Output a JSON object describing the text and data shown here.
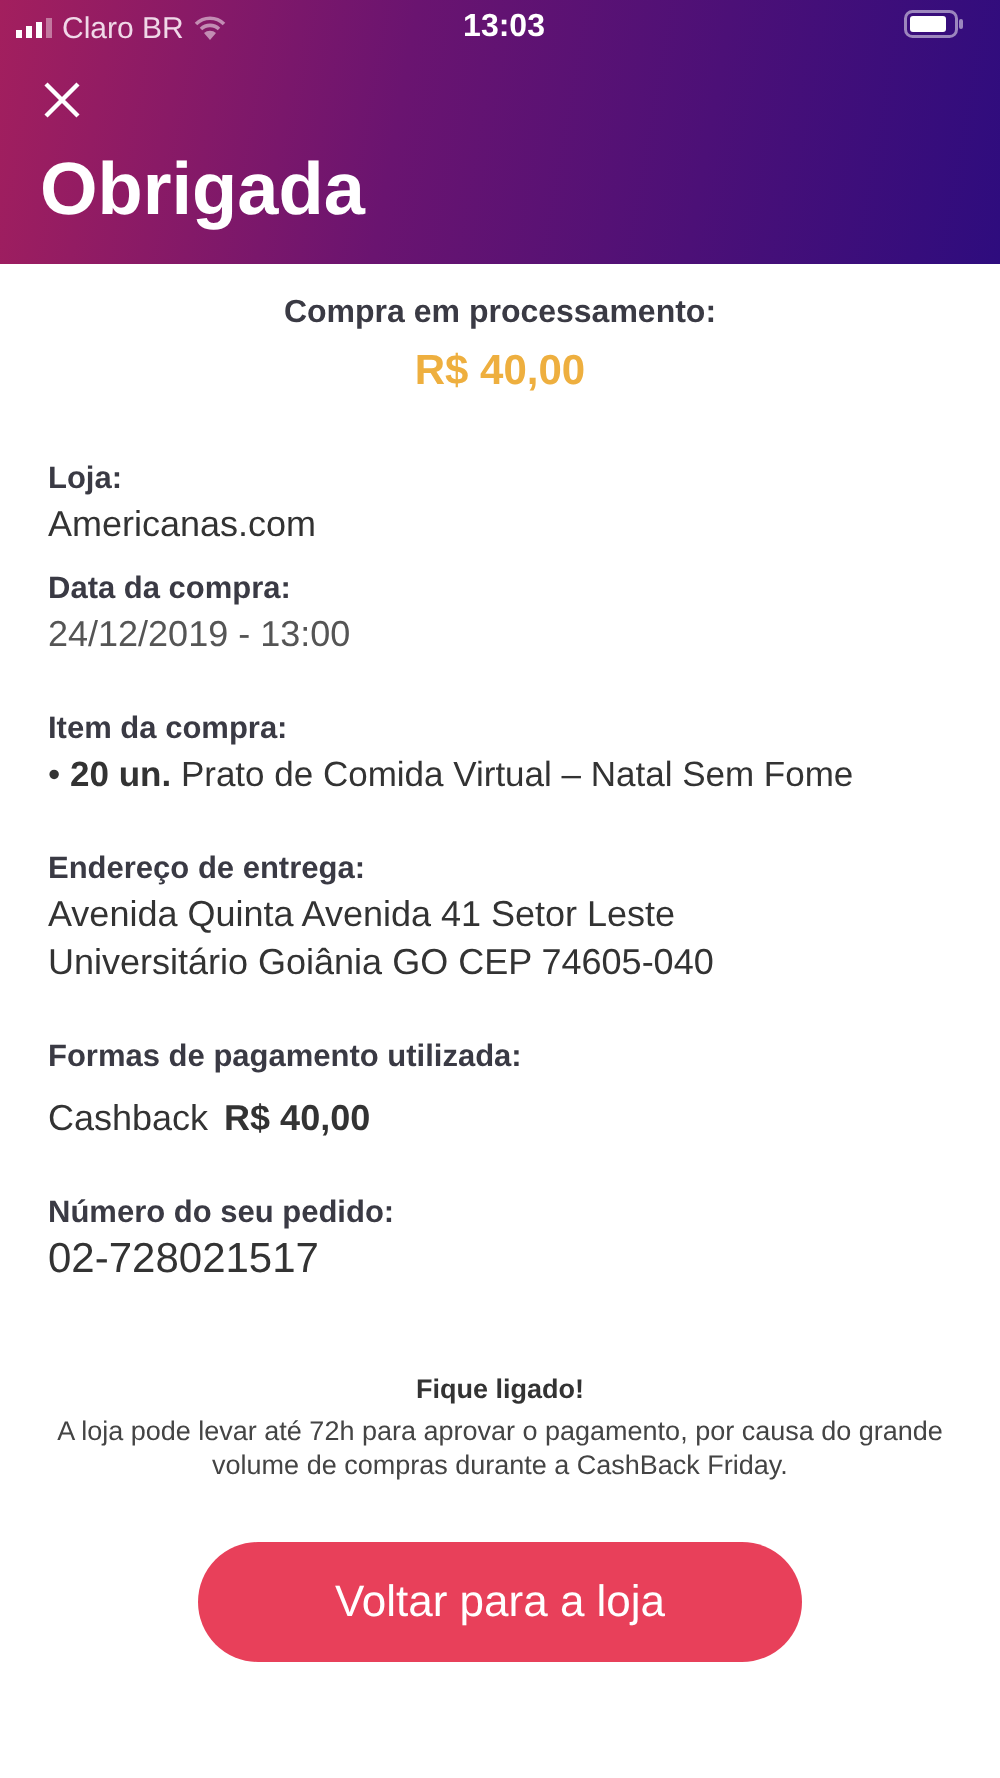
{
  "status_bar": {
    "carrier": "Claro BR",
    "time": "13:03"
  },
  "header": {
    "title": "Obrigada"
  },
  "summary": {
    "label": "Compra em processamento:",
    "amount": "R$ 40,00"
  },
  "store": {
    "label": "Loja:",
    "value": "Americanas.com"
  },
  "date": {
    "label": "Data da compra:",
    "value": "24/12/2019 - 13:00"
  },
  "items": {
    "label": "Item da compra:",
    "lines": [
      "• **20 un.** Prato de Comida Virtual – Natal Sem Fome"
    ]
  },
  "address": {
    "label": "Endereço de entrega:",
    "lines": [
      "Avenida Quinta Avenida  41  Setor Leste",
      "Universitário  Goiânia  GO CEP 74605-040"
    ]
  },
  "payment": {
    "label": "Formas de pagamento utilizada:",
    "method": "Cashback",
    "amount": "R$ 40,00"
  },
  "order": {
    "label": "Número do seu pedido:",
    "value": "02-728021517"
  },
  "notice": {
    "title": "Fique ligado!",
    "text": "A loja pode levar até 72h para aprovar o pagamento, por causa do grande volume de compras durante a CashBack Friday."
  },
  "button": {
    "label": "Voltar para a loja"
  }
}
